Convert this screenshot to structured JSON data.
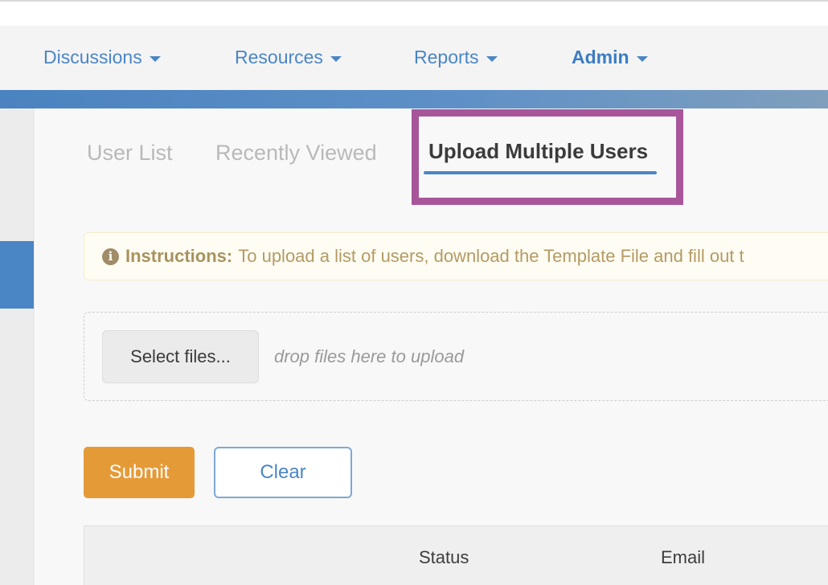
{
  "nav": {
    "items": [
      {
        "label": "Discussions"
      },
      {
        "label": "Resources"
      },
      {
        "label": "Reports"
      },
      {
        "label": "Admin"
      }
    ]
  },
  "tabs": [
    {
      "label": "User List"
    },
    {
      "label": "Recently Viewed"
    },
    {
      "label": "Upload Multiple Users"
    }
  ],
  "instructions": {
    "icon": "info-icon",
    "label": "Instructions:",
    "text": "To upload a list of users, download the Template File and fill out t"
  },
  "upload": {
    "select_label": "Select files...",
    "drop_hint": "drop files here to upload"
  },
  "actions": {
    "submit_label": "Submit",
    "clear_label": "Clear"
  },
  "table": {
    "columns": [
      "Status",
      "Email"
    ]
  },
  "colors": {
    "accent": "#4a86c5",
    "submit": "#e59a38",
    "highlight": "#a8559a"
  }
}
